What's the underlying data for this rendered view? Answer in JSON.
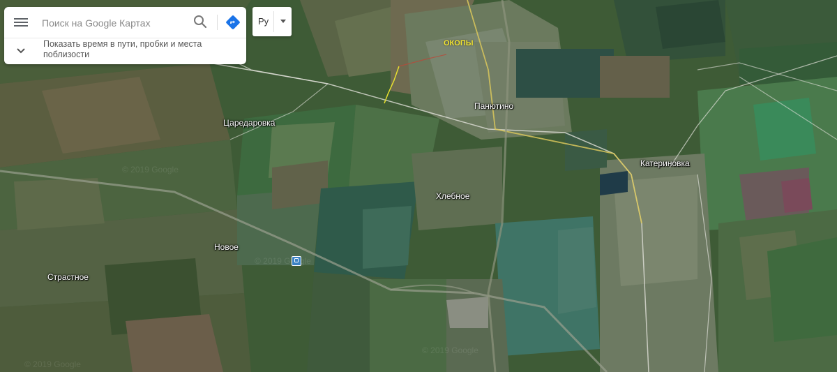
{
  "search": {
    "placeholder": "Поиск на Google Картах",
    "expand_text": "Показать время в пути, пробки и места поблизости"
  },
  "language": {
    "selected": "Ру"
  },
  "icons": {
    "menu": "hamburger-menu-icon",
    "search": "search-icon",
    "directions": "directions-icon",
    "expand": "chevron-down-icon",
    "language_caret": "caret-down-icon",
    "railway_station": "train-station-icon"
  },
  "map": {
    "type": "satellite",
    "places": {
      "panyutino": "Панютино",
      "tsaredarovka": "Царедаровка",
      "katerinovka": "Катериновка",
      "khlebnoe": "Хлебное",
      "novoe": "Новое",
      "strastnoe": "Страстное"
    },
    "annotation": "ОКОПЫ",
    "annotation_color": "#f2e531",
    "trench_color": "#e8e030",
    "trench_red_color": "#b84a3a",
    "watermark": "© 2019 Google"
  },
  "colors": {
    "directions_accent": "#1a73e8",
    "road_white": "#e8e8e8",
    "road_yellow": "#d9c75c"
  }
}
